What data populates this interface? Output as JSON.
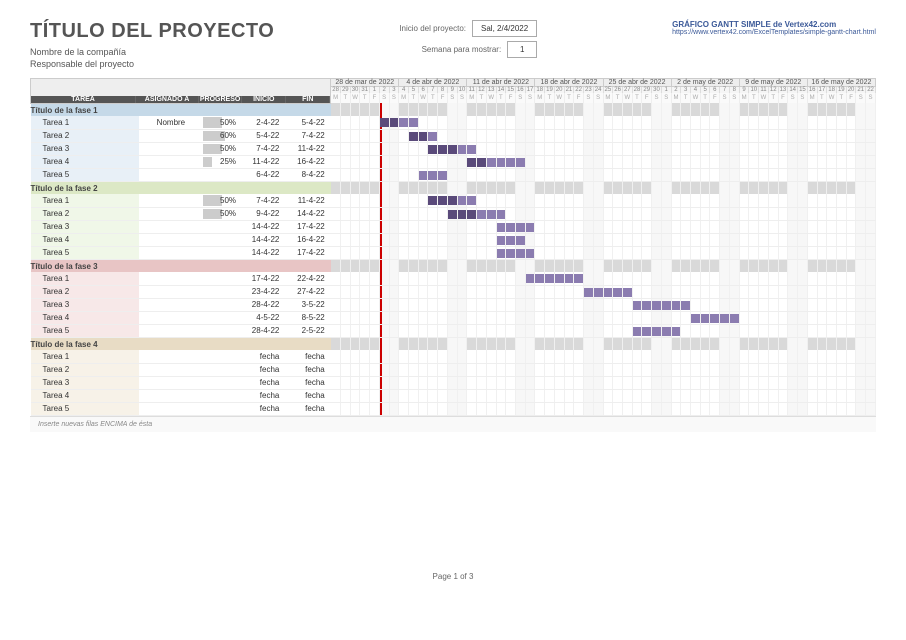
{
  "header": {
    "title": "TÍTULO DEL PROYECTO",
    "company": "Nombre de la compañía",
    "responsible": "Responsable del proyecto",
    "start_label": "Inicio del proyecto:",
    "start_value": "Sal, 2/4/2022",
    "week_label": "Semana para mostrar:",
    "week_value": "1",
    "chart_title": "GRÁFICO GANTT SIMPLE de Vertex42.com",
    "chart_link": "https://www.vertex42.com/ExcelTemplates/simple-gantt-chart.html"
  },
  "columns": {
    "task": "TAREA",
    "assigned": "ASIGNADO A",
    "progress": "PROGRESO",
    "start": "INICIO",
    "end": "FIN"
  },
  "weeks": [
    "28 de mar de 2022",
    "4 de abr de 2022",
    "11 de abr de 2022",
    "18 de abr de 2022",
    "25 de abr de 2022",
    "2 de may de 2022",
    "9 de may de 2022",
    "16 de may de 2022"
  ],
  "days": [
    "28",
    "29",
    "30",
    "31",
    "1",
    "2",
    "3",
    "4",
    "5",
    "6",
    "7",
    "8",
    "9",
    "10",
    "11",
    "12",
    "13",
    "14",
    "15",
    "16",
    "17",
    "18",
    "19",
    "20",
    "21",
    "22",
    "23",
    "24",
    "25",
    "26",
    "27",
    "28",
    "29",
    "30",
    "1",
    "2",
    "3",
    "4",
    "5",
    "6",
    "7",
    "8",
    "9",
    "10",
    "11",
    "12",
    "13",
    "14",
    "15",
    "16",
    "17",
    "18",
    "19",
    "20",
    "21",
    "22"
  ],
  "dows": [
    "M",
    "T",
    "W",
    "T",
    "F",
    "S",
    "S",
    "M",
    "T",
    "W",
    "T",
    "F",
    "S",
    "S",
    "M",
    "T",
    "W",
    "T",
    "F",
    "S",
    "S",
    "M",
    "T",
    "W",
    "T",
    "F",
    "S",
    "S",
    "M",
    "T",
    "W",
    "T",
    "F",
    "S",
    "S",
    "M",
    "T",
    "W",
    "T",
    "F",
    "S",
    "S",
    "M",
    "T",
    "W",
    "T",
    "F",
    "S",
    "S",
    "M",
    "T",
    "W",
    "T",
    "F",
    "S",
    "S"
  ],
  "today_col": 5,
  "phases": [
    {
      "name": "Título de la fase 1",
      "cls": "p1",
      "tasks": [
        {
          "name": "Tarea 1",
          "assigned": "Nombre",
          "progress": "50%",
          "start": "2-4-22",
          "end": "5-4-22",
          "bar_start": 5,
          "bar_len": 4,
          "prog_len": 2
        },
        {
          "name": "Tarea 2",
          "assigned": "",
          "progress": "60%",
          "start": "5-4-22",
          "end": "7-4-22",
          "bar_start": 8,
          "bar_len": 3,
          "prog_len": 2
        },
        {
          "name": "Tarea 3",
          "assigned": "",
          "progress": "50%",
          "start": "7-4-22",
          "end": "11-4-22",
          "bar_start": 10,
          "bar_len": 5,
          "prog_len": 3
        },
        {
          "name": "Tarea 4",
          "assigned": "",
          "progress": "25%",
          "start": "11-4-22",
          "end": "16-4-22",
          "bar_start": 14,
          "bar_len": 6,
          "prog_len": 2
        },
        {
          "name": "Tarea 5",
          "assigned": "",
          "progress": "",
          "start": "6-4-22",
          "end": "8-4-22",
          "bar_start": 9,
          "bar_len": 3,
          "prog_len": 0
        }
      ]
    },
    {
      "name": "Título de la fase 2",
      "cls": "p2",
      "tasks": [
        {
          "name": "Tarea 1",
          "assigned": "",
          "progress": "50%",
          "start": "7-4-22",
          "end": "11-4-22",
          "bar_start": 10,
          "bar_len": 5,
          "prog_len": 3
        },
        {
          "name": "Tarea 2",
          "assigned": "",
          "progress": "50%",
          "start": "9-4-22",
          "end": "14-4-22",
          "bar_start": 12,
          "bar_len": 6,
          "prog_len": 3
        },
        {
          "name": "Tarea 3",
          "assigned": "",
          "progress": "",
          "start": "14-4-22",
          "end": "17-4-22",
          "bar_start": 17,
          "bar_len": 4,
          "prog_len": 0
        },
        {
          "name": "Tarea 4",
          "assigned": "",
          "progress": "",
          "start": "14-4-22",
          "end": "16-4-22",
          "bar_start": 17,
          "bar_len": 3,
          "prog_len": 0
        },
        {
          "name": "Tarea 5",
          "assigned": "",
          "progress": "",
          "start": "14-4-22",
          "end": "17-4-22",
          "bar_start": 17,
          "bar_len": 4,
          "prog_len": 0
        }
      ]
    },
    {
      "name": "Título de la fase 3",
      "cls": "p3",
      "tasks": [
        {
          "name": "Tarea 1",
          "assigned": "",
          "progress": "",
          "start": "17-4-22",
          "end": "22-4-22",
          "bar_start": 20,
          "bar_len": 6,
          "prog_len": 0
        },
        {
          "name": "Tarea 2",
          "assigned": "",
          "progress": "",
          "start": "23-4-22",
          "end": "27-4-22",
          "bar_start": 26,
          "bar_len": 5,
          "prog_len": 0
        },
        {
          "name": "Tarea 3",
          "assigned": "",
          "progress": "",
          "start": "28-4-22",
          "end": "3-5-22",
          "bar_start": 31,
          "bar_len": 6,
          "prog_len": 0
        },
        {
          "name": "Tarea 4",
          "assigned": "",
          "progress": "",
          "start": "4-5-22",
          "end": "8-5-22",
          "bar_start": 37,
          "bar_len": 5,
          "prog_len": 0
        },
        {
          "name": "Tarea 5",
          "assigned": "",
          "progress": "",
          "start": "28-4-22",
          "end": "2-5-22",
          "bar_start": 31,
          "bar_len": 5,
          "prog_len": 0
        }
      ]
    },
    {
      "name": "Título de la fase 4",
      "cls": "p4",
      "tasks": [
        {
          "name": "Tarea 1",
          "assigned": "",
          "progress": "",
          "start": "fecha",
          "end": "fecha",
          "bar_start": -1,
          "bar_len": 0,
          "prog_len": 0
        },
        {
          "name": "Tarea 2",
          "assigned": "",
          "progress": "",
          "start": "fecha",
          "end": "fecha",
          "bar_start": -1,
          "bar_len": 0,
          "prog_len": 0
        },
        {
          "name": "Tarea 3",
          "assigned": "",
          "progress": "",
          "start": "fecha",
          "end": "fecha",
          "bar_start": -1,
          "bar_len": 0,
          "prog_len": 0
        },
        {
          "name": "Tarea 4",
          "assigned": "",
          "progress": "",
          "start": "fecha",
          "end": "fecha",
          "bar_start": -1,
          "bar_len": 0,
          "prog_len": 0
        },
        {
          "name": "Tarea 5",
          "assigned": "",
          "progress": "",
          "start": "fecha",
          "end": "fecha",
          "bar_start": -1,
          "bar_len": 0,
          "prog_len": 0
        }
      ]
    }
  ],
  "footer_note": "Inserte nuevas filas ENCIMA de ésta",
  "page_label": "Page 1 of 3",
  "chart_data": {
    "type": "gantt",
    "title": "TÍTULO DEL PROYECTO",
    "x_range": [
      "2022-03-28",
      "2022-05-22"
    ],
    "today": "2022-04-02",
    "series": [
      {
        "phase": "Título de la fase 1",
        "task": "Tarea 1",
        "start": "2022-04-02",
        "end": "2022-04-05",
        "progress": 0.5
      },
      {
        "phase": "Título de la fase 1",
        "task": "Tarea 2",
        "start": "2022-04-05",
        "end": "2022-04-07",
        "progress": 0.6
      },
      {
        "phase": "Título de la fase 1",
        "task": "Tarea 3",
        "start": "2022-04-07",
        "end": "2022-04-11",
        "progress": 0.5
      },
      {
        "phase": "Título de la fase 1",
        "task": "Tarea 4",
        "start": "2022-04-11",
        "end": "2022-04-16",
        "progress": 0.25
      },
      {
        "phase": "Título de la fase 1",
        "task": "Tarea 5",
        "start": "2022-04-06",
        "end": "2022-04-08",
        "progress": null
      },
      {
        "phase": "Título de la fase 2",
        "task": "Tarea 1",
        "start": "2022-04-07",
        "end": "2022-04-11",
        "progress": 0.5
      },
      {
        "phase": "Título de la fase 2",
        "task": "Tarea 2",
        "start": "2022-04-09",
        "end": "2022-04-14",
        "progress": 0.5
      },
      {
        "phase": "Título de la fase 2",
        "task": "Tarea 3",
        "start": "2022-04-14",
        "end": "2022-04-17",
        "progress": null
      },
      {
        "phase": "Título de la fase 2",
        "task": "Tarea 4",
        "start": "2022-04-14",
        "end": "2022-04-16",
        "progress": null
      },
      {
        "phase": "Título de la fase 2",
        "task": "Tarea 5",
        "start": "2022-04-14",
        "end": "2022-04-17",
        "progress": null
      },
      {
        "phase": "Título de la fase 3",
        "task": "Tarea 1",
        "start": "2022-04-17",
        "end": "2022-04-22",
        "progress": null
      },
      {
        "phase": "Título de la fase 3",
        "task": "Tarea 2",
        "start": "2022-04-23",
        "end": "2022-04-27",
        "progress": null
      },
      {
        "phase": "Título de la fase 3",
        "task": "Tarea 3",
        "start": "2022-04-28",
        "end": "2022-05-03",
        "progress": null
      },
      {
        "phase": "Título de la fase 3",
        "task": "Tarea 4",
        "start": "2022-05-04",
        "end": "2022-05-08",
        "progress": null
      },
      {
        "phase": "Título de la fase 3",
        "task": "Tarea 5",
        "start": "2022-04-28",
        "end": "2022-05-02",
        "progress": null
      }
    ]
  }
}
